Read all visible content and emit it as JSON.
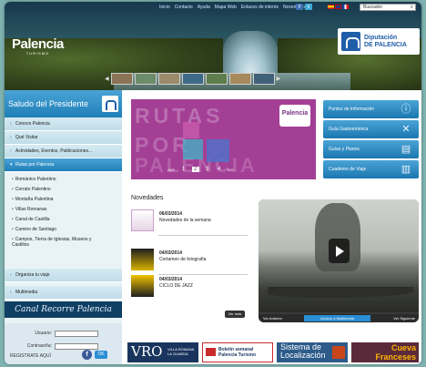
{
  "header": {
    "top_links": [
      "Inicio",
      "Contacto",
      "Ayuda",
      "Mapa Web",
      "Enlaces de interés",
      "Novedades"
    ],
    "search_placeholder": "Buscador",
    "logo_name": "Palencia",
    "logo_sub": "TURISMO",
    "diputacion_line1": "Diputación",
    "diputacion_line2": "DE PALENCIA"
  },
  "sidebar": {
    "saludo": "Saludo del Presidente",
    "items": [
      {
        "label": "Conoce Palencia"
      },
      {
        "label": "Qué Visitar"
      },
      {
        "label": "Actividades, Eventos, Publicaciones..."
      },
      {
        "label": "Rutas por Palencia"
      }
    ],
    "sub_items": [
      {
        "label": "Románico Palentino"
      },
      {
        "label": "Cerrato Palentino"
      },
      {
        "label": "Montaña Palentina"
      },
      {
        "label": "Villas Romanas"
      },
      {
        "label": "Canal de Castilla"
      },
      {
        "label": "Camino de Santiago"
      },
      {
        "label": "Campos, Tierra de Iglesias, Museos y Castillos"
      }
    ],
    "bottom_items": [
      {
        "label": "Organiza tu viaje"
      },
      {
        "label": "Multimedia"
      }
    ],
    "canal": "Canal Recorre Palencia",
    "login": {
      "usuario_label": "Usuario:",
      "password_label": "Contraseña:",
      "register_label": "REGISTRATE AQUÍ",
      "ok_label": "OK"
    }
  },
  "banner": {
    "line1": "RUTAS",
    "line2": "POR",
    "line3": "PALENCIA",
    "logo": "Palencia",
    "prev": "ANT.",
    "pages": [
      "1",
      "2",
      "3",
      "4"
    ],
    "next": "SIG."
  },
  "right_buttons": [
    {
      "label": "Puntos de Información"
    },
    {
      "label": "Guía Gastronómica"
    },
    {
      "label": "Guías y Planos"
    },
    {
      "label": "Cuaderno de Viaje"
    }
  ],
  "news": {
    "heading": "Novedades",
    "items": [
      {
        "date": "06/03/2014",
        "title": "Novedades de la semana"
      },
      {
        "date": "04/03/2014",
        "title": "Certamen de fotografía"
      },
      {
        "date": "04/03/2014",
        "title": "CICLO DE JAZZ"
      }
    ],
    "ver_mas": "Ver más"
  },
  "video": {
    "prev": "Ver Anterior",
    "center": "Acceso a Multimedia",
    "next": "Ver Siguiente"
  },
  "footer": {
    "vro_big": "VRO",
    "vro_sub1": "VILLA ROMANA",
    "vro_sub2": "LA OLMEDA",
    "boletin1": "Boletín semanal",
    "boletin2": "Palencia Turismo",
    "sistema1": "Sistema de",
    "sistema2": "Localización",
    "cueva1": "Cueva",
    "cueva2": "Franceses"
  }
}
